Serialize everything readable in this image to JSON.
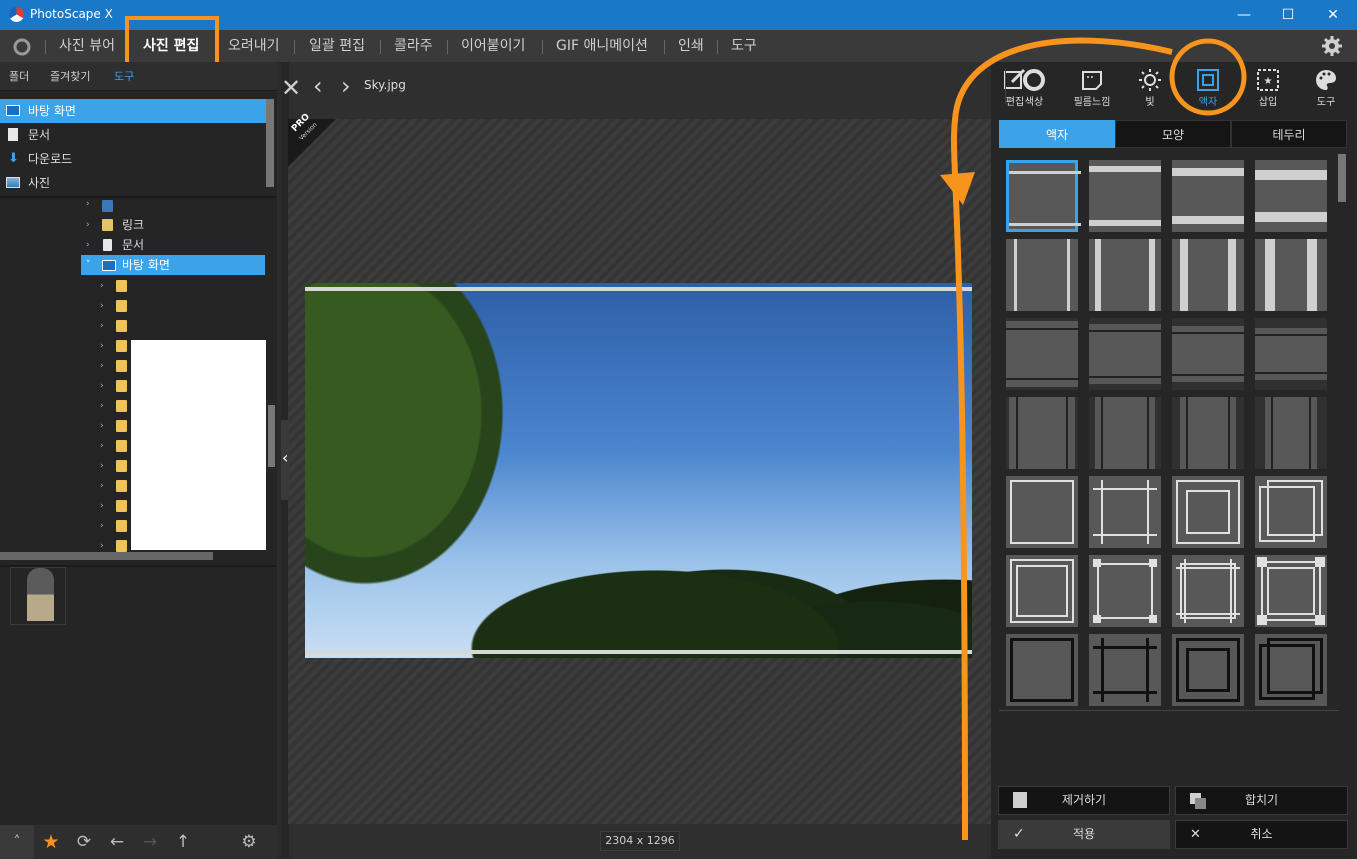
{
  "window": {
    "title": "PhotoScape X",
    "minimize": "—",
    "maximize": "☐",
    "close": "✕"
  },
  "menu": {
    "items": [
      "사진 뷰어",
      "사진 편집",
      "오려내기",
      "일괄 편집",
      "콜라주",
      "이어붙이기",
      "GIF 애니메이션",
      "인쇄",
      "도구"
    ],
    "active": "사진 편집"
  },
  "left": {
    "tabs": [
      "폴더",
      "즐겨찾기",
      "도구"
    ],
    "favorites": [
      "바탕 화면",
      "문서",
      "다운로드",
      "사진"
    ],
    "tree": {
      "items": [
        "링크",
        "문서",
        "바탕 화면"
      ]
    }
  },
  "editor": {
    "filename": "Sky.jpg",
    "dimensions": "2304 x 1296",
    "pro_badge": "PRO",
    "pro_badge_sub": "Version"
  },
  "tools": [
    "편집",
    "색상",
    "필름느낌",
    "빛",
    "액자",
    "삽입",
    "도구"
  ],
  "active_tool": "액자",
  "subtabs": [
    "액자",
    "모양",
    "테두리"
  ],
  "actions": {
    "remove": "제거하기",
    "merge": "합치기",
    "apply": "적용",
    "cancel": "취소"
  },
  "colors": {
    "accent": "#1a78c8",
    "highlight": "#f7941d",
    "selection": "#3da3e8"
  }
}
